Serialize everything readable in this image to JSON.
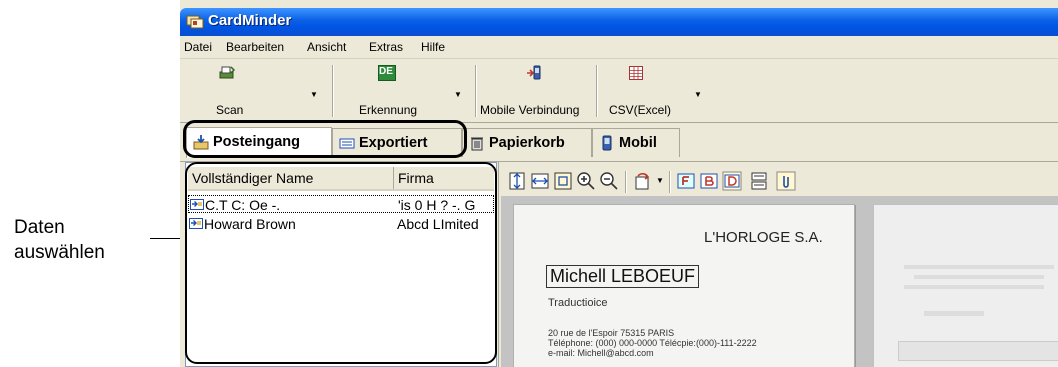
{
  "annotation": {
    "line1": "Daten",
    "line2": "auswählen"
  },
  "window": {
    "title": "CardMinder"
  },
  "menu": [
    "Datei",
    "Bearbeiten",
    "Ansicht",
    "Extras",
    "Hilfe"
  ],
  "toolbar": {
    "scan": "Scan",
    "recognition": "Erkennung",
    "recognition_badge": "DE",
    "mobile": "Mobile Verbindung",
    "csv": "CSV(Excel)"
  },
  "tabs": [
    "Posteingang",
    "Exportiert",
    "Papierkorb",
    "Mobil"
  ],
  "list": {
    "columns": [
      "Vollständiger Name",
      "Firma"
    ],
    "rows": [
      {
        "name": "C.T C: Oe -.",
        "company": "'is 0 H ? -. G"
      },
      {
        "name": "Howard Brown",
        "company": "Abcd LImited"
      }
    ]
  },
  "card": {
    "company": "L'HORLOGE S.A.",
    "name": "Michell LEBOEUF",
    "role": "Traductioice",
    "address": "20 rue de l'Espoir 75315 PARIS",
    "phone": "Téléphone: (000) 000-0000   Télécpie:(000)-111-2222",
    "email": "e-mail: Michell@abcd.com"
  },
  "colors": {
    "titlebar": "#0054e3",
    "chrome": "#ece9d8",
    "highlight": "#000000"
  }
}
